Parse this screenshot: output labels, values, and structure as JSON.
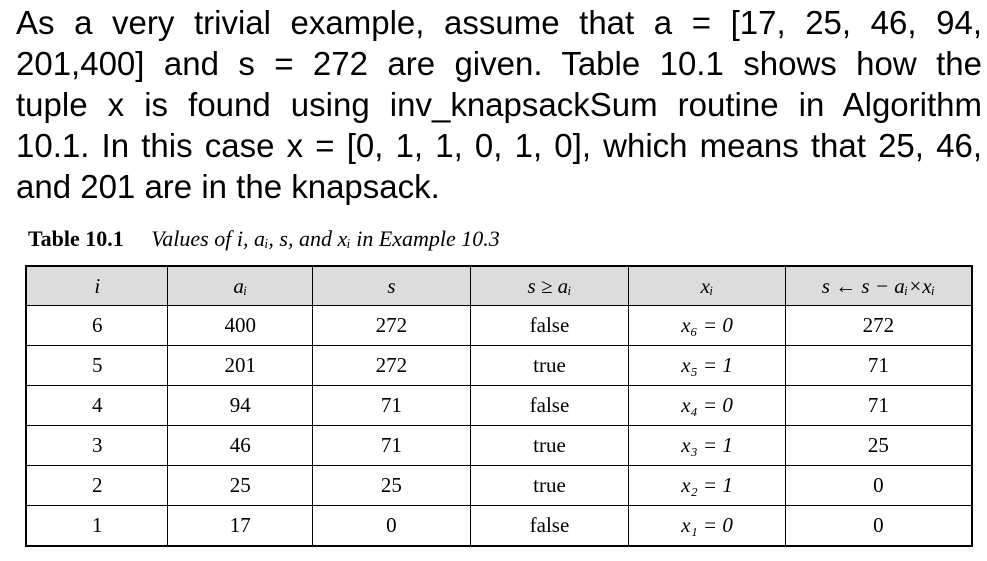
{
  "paragraph": {
    "lines": [
      "As a very trivial example, assume that a = [17, 25, 46, 94,",
      "201,400] and s = 272 are given. Table 10.1 shows how the",
      "tuple x is found using inv_knapsackSum routine in Algorithm",
      "10.1. In this case x = [0, 1, 1, 0, 1, 0], which means that 25, 46,",
      "and 201 are in the knapsack."
    ]
  },
  "caption": {
    "label": "Table 10.1",
    "title": "Values of i, aᵢ, s, and xᵢ in Example 10.3"
  },
  "table": {
    "headers": [
      "i",
      "aᵢ",
      "s",
      "s ≥ aᵢ",
      "xᵢ",
      "s ← s − aᵢ×xᵢ"
    ],
    "rows": [
      {
        "i": "6",
        "a": "400",
        "s": "272",
        "cmp": "false",
        "x": "x₆ = 0",
        "snew": "272"
      },
      {
        "i": "5",
        "a": "201",
        "s": "272",
        "cmp": "true",
        "x": "x₅ = 1",
        "snew": "71"
      },
      {
        "i": "4",
        "a": "94",
        "s": "71",
        "cmp": "false",
        "x": "x₄ = 0",
        "snew": "71"
      },
      {
        "i": "3",
        "a": "46",
        "s": "71",
        "cmp": "true",
        "x": "x₃ = 1",
        "snew": "25"
      },
      {
        "i": "2",
        "a": "25",
        "s": "25",
        "cmp": "true",
        "x": "x₂ = 1",
        "snew": "0"
      },
      {
        "i": "1",
        "a": "17",
        "s": "0",
        "cmp": "false",
        "x": "x₁ = 0",
        "snew": "0"
      }
    ]
  }
}
